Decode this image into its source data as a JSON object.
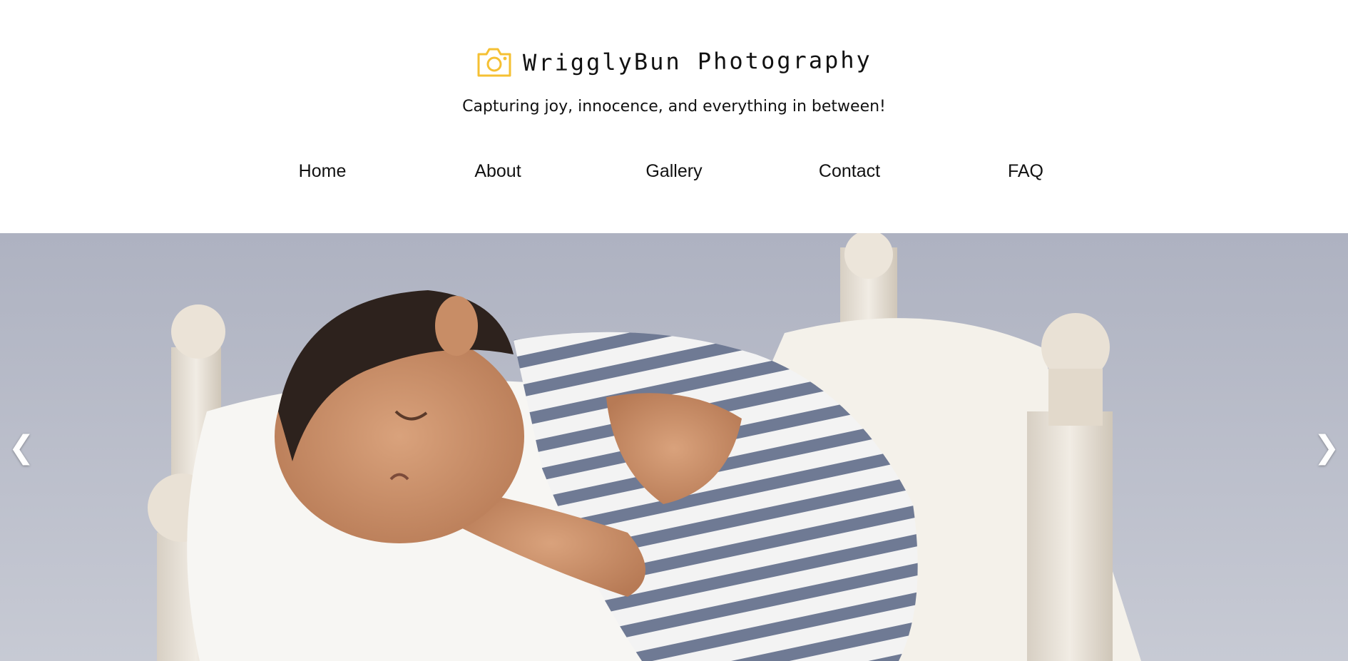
{
  "header": {
    "logo_icon": "camera-icon",
    "title": "WrigglyBun Photography",
    "tagline": "Capturing joy, innocence, and everything in between!"
  },
  "nav": {
    "items": [
      {
        "label": "Home"
      },
      {
        "label": "About"
      },
      {
        "label": "Gallery"
      },
      {
        "label": "Contact"
      },
      {
        "label": "FAQ"
      }
    ]
  },
  "hero": {
    "image": "sleeping-newborn-on-wooden-bed-photo",
    "prev_glyph": "❮",
    "next_glyph": "❯"
  },
  "colors": {
    "accent": "#f5c033",
    "background": "#ffffff",
    "text": "#111111"
  }
}
